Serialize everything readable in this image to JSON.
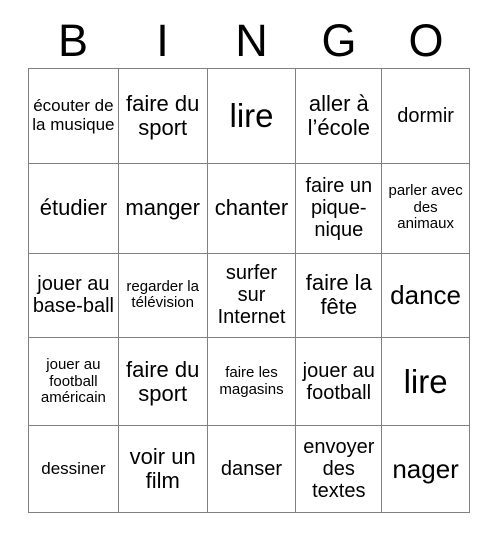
{
  "card": {
    "title_letters": [
      "B",
      "I",
      "N",
      "G",
      "O"
    ],
    "columns": 5,
    "rows": 5,
    "grid_border_color": "#808080",
    "text_color": "#000000",
    "background_color": "#ffffff",
    "cells": [
      [
        {
          "text": "écouter de la musique",
          "size": "sm"
        },
        {
          "text": "faire du sport",
          "size": "lg"
        },
        {
          "text": "lire",
          "size": "xxl"
        },
        {
          "text": "aller à l’école",
          "size": "lg"
        },
        {
          "text": "dormir",
          "size": "md"
        }
      ],
      [
        {
          "text": "étudier",
          "size": "lg"
        },
        {
          "text": "manger",
          "size": "lg"
        },
        {
          "text": "chanter",
          "size": "lg"
        },
        {
          "text": "faire un pique-nique",
          "size": "md"
        },
        {
          "text": "parler avec des animaux",
          "size": "xs"
        }
      ],
      [
        {
          "text": "jouer au base-ball",
          "size": "md"
        },
        {
          "text": "regarder la télévision",
          "size": "xs"
        },
        {
          "text": "surfer sur Internet",
          "size": "md"
        },
        {
          "text": "faire la fête",
          "size": "lg"
        },
        {
          "text": "dance",
          "size": "xl"
        }
      ],
      [
        {
          "text": "jouer au football américain",
          "size": "xs"
        },
        {
          "text": "faire du sport",
          "size": "lg"
        },
        {
          "text": "faire les magasins",
          "size": "xs"
        },
        {
          "text": "jouer au football",
          "size": "md"
        },
        {
          "text": "lire",
          "size": "xxl"
        }
      ],
      [
        {
          "text": "dessiner",
          "size": "sm"
        },
        {
          "text": "voir un film",
          "size": "lg"
        },
        {
          "text": "danser",
          "size": "md"
        },
        {
          "text": "envoyer des textes",
          "size": "md"
        },
        {
          "text": "nager",
          "size": "xl"
        }
      ]
    ]
  }
}
